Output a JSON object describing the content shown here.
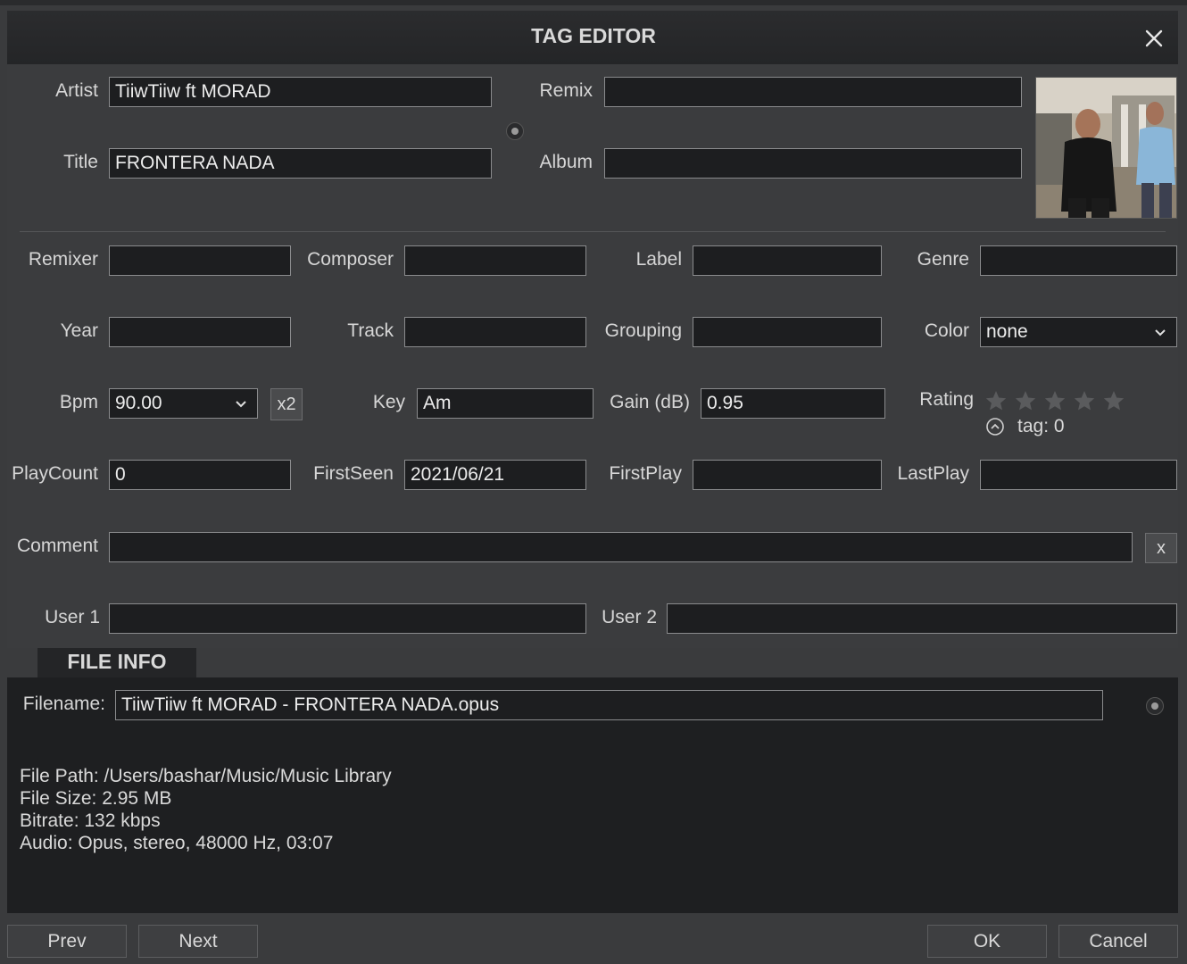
{
  "window": {
    "title": "TAG EDITOR"
  },
  "fields": {
    "artist": {
      "label": "Artist",
      "value": "TiiwTiiw ft MORAD"
    },
    "title": {
      "label": "Title",
      "value": "FRONTERA NADA"
    },
    "remix": {
      "label": "Remix",
      "value": ""
    },
    "album": {
      "label": "Album",
      "value": ""
    },
    "remixer": {
      "label": "Remixer",
      "value": ""
    },
    "composer": {
      "label": "Composer",
      "value": ""
    },
    "label": {
      "label": "Label",
      "value": ""
    },
    "genre": {
      "label": "Genre",
      "value": ""
    },
    "year": {
      "label": "Year",
      "value": ""
    },
    "track": {
      "label": "Track",
      "value": ""
    },
    "grouping": {
      "label": "Grouping",
      "value": ""
    },
    "color": {
      "label": "Color",
      "value": "none"
    },
    "bpm": {
      "label": "Bpm",
      "value": "90.00"
    },
    "bpm_x2": "x2",
    "key": {
      "label": "Key",
      "value": "Am"
    },
    "gain": {
      "label": "Gain (dB)",
      "value": "0.95"
    },
    "rating": {
      "label": "Rating",
      "stars": 0,
      "max": 5,
      "tag_text": "tag: 0"
    },
    "playcount": {
      "label": "PlayCount",
      "value": "0"
    },
    "firstseen": {
      "label": "FirstSeen",
      "value": "2021/06/21"
    },
    "firstplay": {
      "label": "FirstPlay",
      "value": ""
    },
    "lastplay": {
      "label": "LastPlay",
      "value": ""
    },
    "comment": {
      "label": "Comment",
      "value": "",
      "clear": "x"
    },
    "user1": {
      "label": "User 1",
      "value": ""
    },
    "user2": {
      "label": "User 2",
      "value": ""
    }
  },
  "file_info": {
    "tab": "FILE INFO",
    "filename_label": "Filename:",
    "filename": "TiiwTiiw ft MORAD - FRONTERA NADA.opus",
    "path": "File Path: /Users/bashar/Music/Music Library",
    "size": "File Size: 2.95 MB",
    "bitrate": "Bitrate: 132 kbps",
    "audio": "Audio: Opus, stereo, 48000 Hz, 03:07"
  },
  "buttons": {
    "prev": "Prev",
    "next": "Next",
    "ok": "OK",
    "cancel": "Cancel"
  },
  "icons": [
    "close-icon",
    "chevron-down-icon",
    "star-icon",
    "chevron-up-circle-icon",
    "radio-dot-icon"
  ],
  "colors": {
    "background": "#3a3b3d",
    "field_bg": "#1d1e20",
    "panel_bg": "#1e1f21",
    "text": "#d9d9d9"
  }
}
